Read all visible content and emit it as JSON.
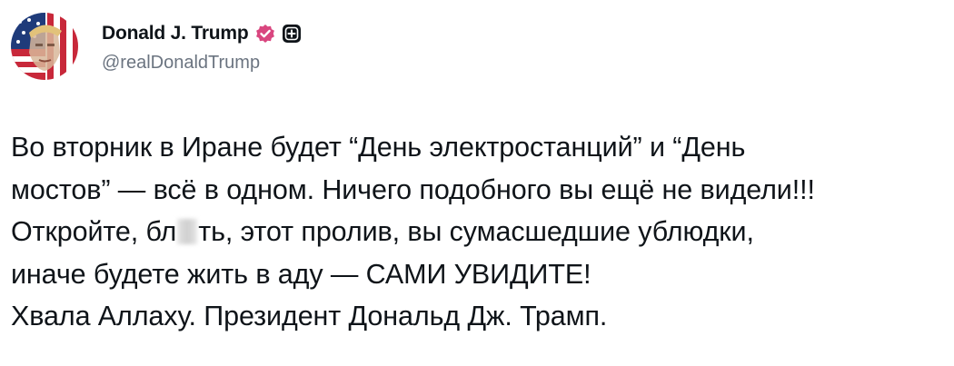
{
  "author": {
    "display_name": "Donald J. Trump",
    "handle": "@realDonaldTrump",
    "avatar_icon": "avatar-flag-portrait-icon",
    "verified_badge_icon": "verified-badge-icon",
    "affiliate_badge_icon": "affiliate-badge-icon",
    "verified_color": "#d9467f"
  },
  "post": {
    "line1": "Во вторник в Иране будет “День электростанций” и “День",
    "line2": "мостов” — всё в одном. Ничего подобного вы ещё не видели!!!",
    "line3_a": "Откройте, бл",
    "line3_b": "ть, этот пролив, вы сумасшедшие ублюдки,",
    "line4": "иначе будете жить в аду — САМИ УВИДИТЕ!",
    "line5": "Хвала Аллаху. Президент Дональд Дж. Трамп."
  }
}
